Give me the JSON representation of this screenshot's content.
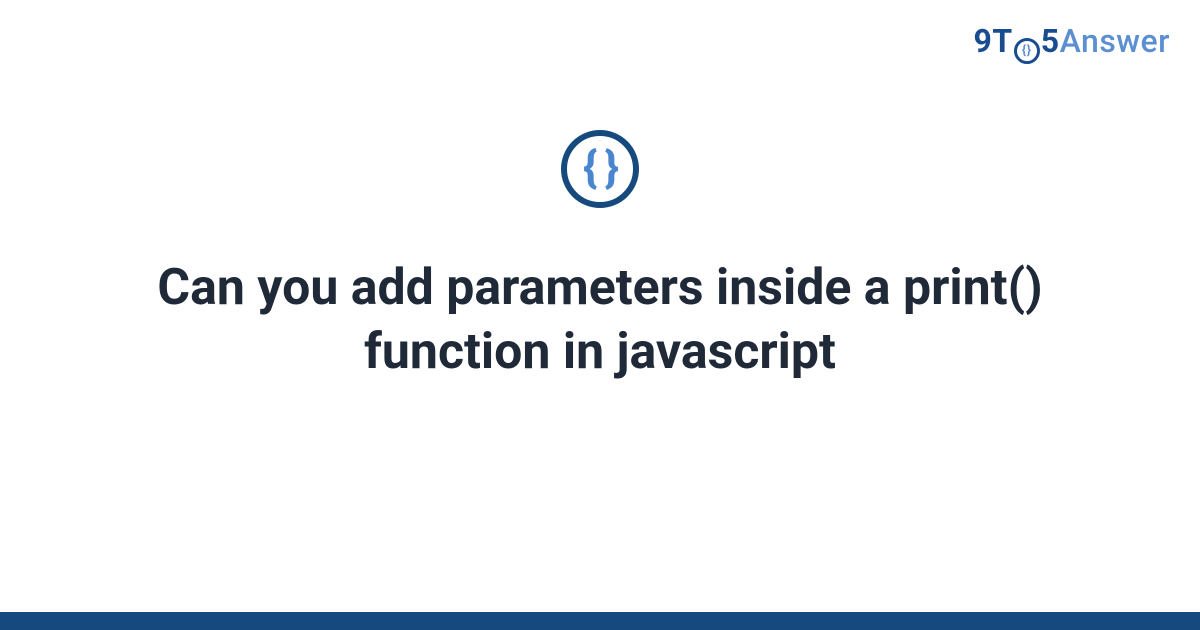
{
  "brand": {
    "part1": "9T",
    "circle_inner": "{}",
    "part2": "5",
    "part3": "Answer"
  },
  "icon": {
    "braces": "{ }"
  },
  "title": "Can you add parameters inside a print() function in javascript",
  "colors": {
    "brand_dark": "#164a7f",
    "brand_light": "#5b8fd1",
    "text": "#1f2937"
  }
}
